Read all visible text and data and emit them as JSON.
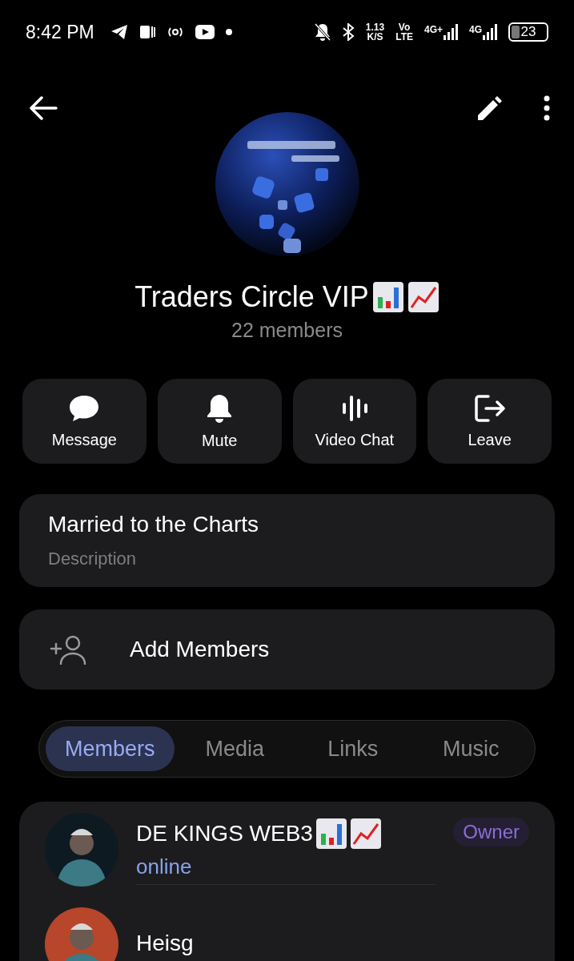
{
  "status_bar": {
    "time": "8:42 PM",
    "speed": "1.13",
    "speed_unit": "K/S",
    "volte_top": "Vo",
    "volte_bottom": "LTE",
    "network_1": "4G+",
    "network_2": "4G",
    "battery": "23"
  },
  "group": {
    "name": "Traders Circle VIP",
    "members_count": "22 members"
  },
  "actions": [
    {
      "kind": "message",
      "label": "Message"
    },
    {
      "kind": "mute",
      "label": "Mute"
    },
    {
      "kind": "video",
      "label": "Video Chat"
    },
    {
      "kind": "leave",
      "label": "Leave"
    }
  ],
  "description": {
    "text": "Married to the Charts",
    "label": "Description"
  },
  "add_members": {
    "label": "Add Members"
  },
  "tabs": [
    {
      "label": "Members",
      "selected": true
    },
    {
      "label": "Media",
      "selected": false
    },
    {
      "label": "Links",
      "selected": false
    },
    {
      "label": "Music",
      "selected": false
    }
  ],
  "members": [
    {
      "name": "DE KINGS WEB3",
      "status": "online",
      "role": "Owner"
    },
    {
      "name": "Heisg"
    }
  ]
}
